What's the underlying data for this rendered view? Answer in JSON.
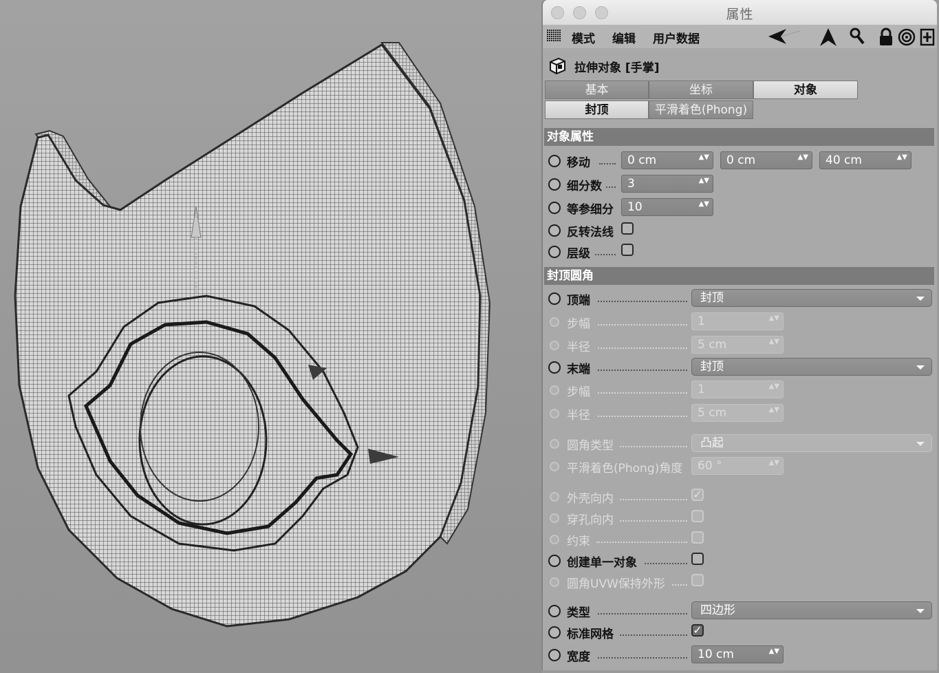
{
  "window": {
    "title": "属性"
  },
  "menu": {
    "items": [
      "模式",
      "编辑",
      "用户数据"
    ]
  },
  "toolbar": {
    "icons": [
      "arrow-left-icon",
      "arrow-up-icon",
      "search-icon",
      "lock-icon",
      "target-icon",
      "add-panel-icon"
    ]
  },
  "object": {
    "title": "拉伸对象 [手掌]",
    "icon": "extrude-object-icon"
  },
  "tabs": {
    "row1": [
      "基本",
      "坐标",
      "对象"
    ],
    "row2": [
      "封顶",
      "平滑着色(Phong)"
    ],
    "active": [
      "对象",
      "封顶"
    ]
  },
  "object_props": {
    "header": "对象属性",
    "move": {
      "label": "移动",
      "values": [
        "0 cm",
        "0 cm",
        "40 cm"
      ]
    },
    "subdiv": {
      "label": "细分数",
      "value": "3"
    },
    "iso_subdiv": {
      "label": "等参细分",
      "value": "10"
    },
    "flip_normals": {
      "label": "反转法线",
      "checked": false
    },
    "hierarchical": {
      "label": "层级",
      "checked": false
    }
  },
  "caps": {
    "header": "封顶圆角",
    "top": {
      "label": "顶端",
      "value": "封顶"
    },
    "top_steps": {
      "label": "步幅",
      "value": "1"
    },
    "top_radius": {
      "label": "半径",
      "value": "5 cm"
    },
    "end": {
      "label": "末端",
      "value": "封顶"
    },
    "end_steps": {
      "label": "步幅",
      "value": "1"
    },
    "end_radius": {
      "label": "半径",
      "value": "5 cm"
    },
    "fillet_type": {
      "label": "圆角类型",
      "value": "凸起"
    },
    "phong_angle": {
      "label": "平滑着色(Phong)角度",
      "value": "60 °"
    },
    "hull_inward": {
      "label": "外壳向内",
      "checked": true
    },
    "hole_inward": {
      "label": "穿孔向内",
      "checked": false
    },
    "constrain": {
      "label": "约束",
      "checked": false
    },
    "single_object": {
      "label": "创建单一对象",
      "checked": false
    },
    "uvw": {
      "label": "圆角UVW保持外形",
      "checked": false
    },
    "type": {
      "label": "类型",
      "value": "四边形"
    },
    "standard_grid": {
      "label": "标准网格",
      "checked": true
    },
    "width": {
      "label": "宽度",
      "value": "10 cm"
    }
  },
  "check_mark": "✓",
  "spinner": "▲▼"
}
